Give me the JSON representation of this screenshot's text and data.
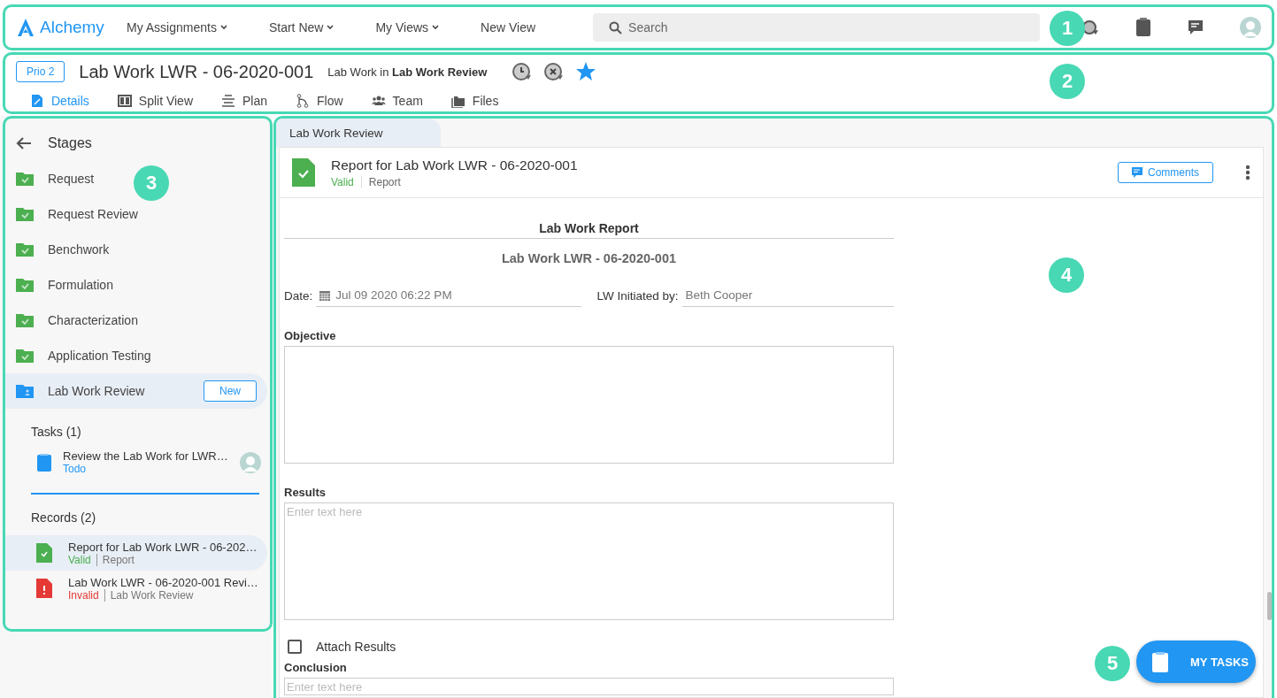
{
  "topbar": {
    "callout": "1",
    "logo": "Alchemy",
    "nav": [
      {
        "label": "My Assignments",
        "has_menu": true
      },
      {
        "label": "Start New",
        "has_menu": true
      },
      {
        "label": "My Views",
        "has_menu": true
      },
      {
        "label": "New View",
        "has_menu": false
      }
    ],
    "search": {
      "placeholder": "Search"
    }
  },
  "header": {
    "callout": "2",
    "priority": "Prio 2",
    "title": "Lab Work LWR - 06-2020-001",
    "subtitle": "Lab Work in **Lab Work Review**",
    "starred": true,
    "tabs": [
      {
        "label": "Details",
        "selected": true
      },
      {
        "label": "Split View",
        "selected": false
      },
      {
        "label": "Plan",
        "selected": false
      },
      {
        "label": "Flow",
        "selected": false
      },
      {
        "label": "Team",
        "selected": false
      },
      {
        "label": "Files",
        "selected": false
      }
    ]
  },
  "sidebar": {
    "callout": "3",
    "title": "Stages",
    "stages": [
      {
        "label": "Request",
        "completed": true,
        "selected": false
      },
      {
        "label": "Request Review",
        "completed": true,
        "selected": false
      },
      {
        "label": "Benchwork",
        "completed": true,
        "selected": false
      },
      {
        "label": "Formulation",
        "completed": true,
        "selected": false
      },
      {
        "label": "Characterization",
        "completed": true,
        "selected": false
      },
      {
        "label": "Application Testing",
        "completed": true,
        "selected": false
      },
      {
        "label": "Lab Work Review",
        "completed": false,
        "selected": true,
        "badge": "New"
      }
    ],
    "tasks_heading": "Tasks (1)",
    "tasks": [
      {
        "title": "Review the Lab Work for LWR…",
        "status": "Todo"
      }
    ],
    "records_heading": "Records (2)",
    "records": [
      {
        "title": "Report for Lab Work LWR - 06-202…",
        "status": "Valid",
        "kind": "valid",
        "type": "Report",
        "selected": true
      },
      {
        "title": "Lab Work LWR - 06-2020-001 Revi…",
        "status": "Invalid",
        "kind": "invalid",
        "type": "Lab Work Review",
        "selected": false
      }
    ]
  },
  "main": {
    "callout": "4",
    "tab": "Lab Work Review",
    "record": {
      "title": "Report for Lab Work LWR - 06-2020-001",
      "status": "Valid",
      "kind": "valid",
      "type": "Report",
      "comments_button": "Comments"
    },
    "form": {
      "heading": "Lab Work Report",
      "subheading": "Lab Work LWR - 06-2020-001",
      "date_label": "Date:",
      "date_value": "Jul 09 2020 06:22 PM",
      "initiator_label": "LW Initiated by:",
      "initiator_value": "Beth Cooper",
      "objective_label": "Objective",
      "results_label": "Results",
      "results_placeholder": "Enter text here",
      "attach": {
        "label": "Attach Results",
        "checked": false
      },
      "conclusion_label": "Conclusion",
      "conclusion_placeholder": "Enter text here"
    }
  },
  "fab": {
    "callout": "5",
    "label": "MY TASKS"
  }
}
